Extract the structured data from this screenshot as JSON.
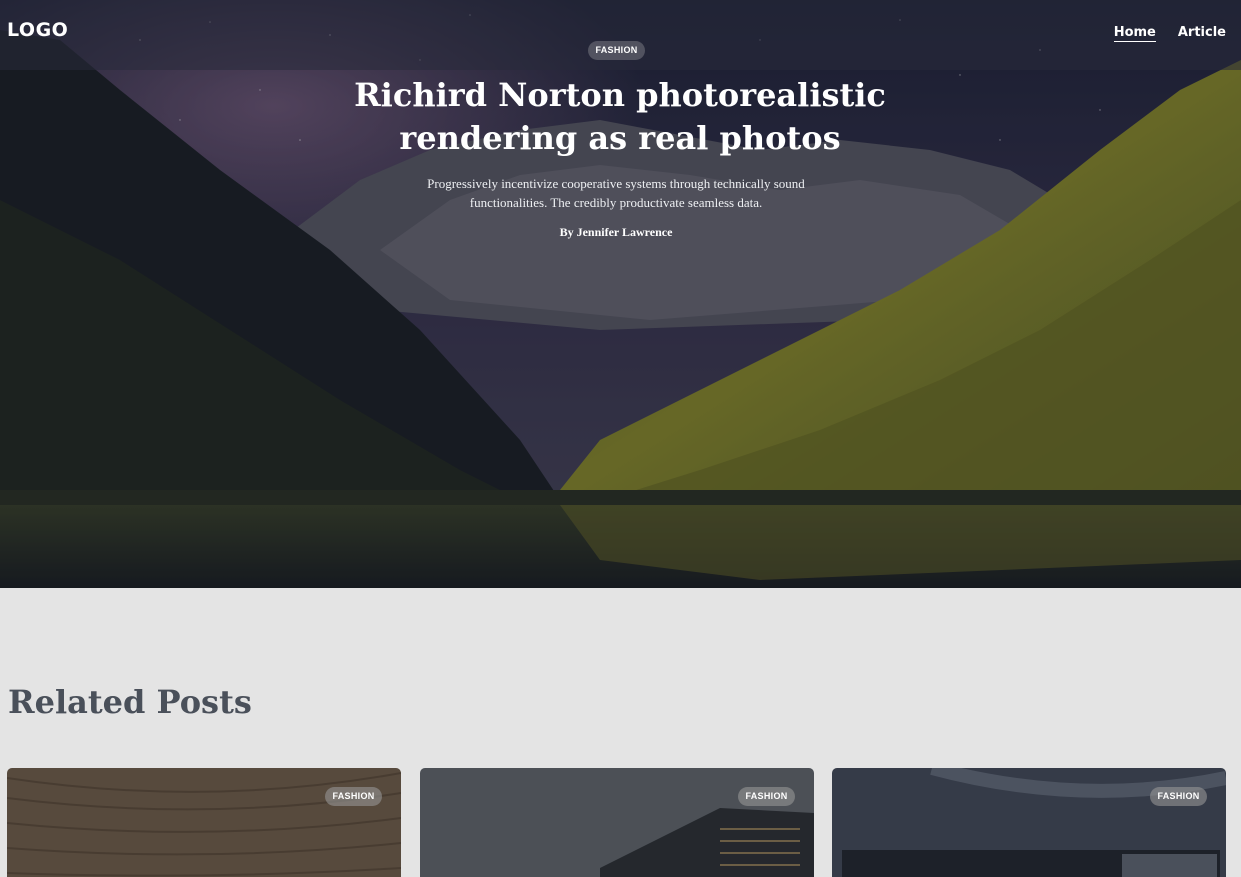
{
  "header": {
    "logo": "LOGO",
    "nav": [
      {
        "label": "Home",
        "active": true
      },
      {
        "label": "Article",
        "active": false
      }
    ]
  },
  "hero": {
    "category": "FASHION",
    "title": "Richird Norton photorealistic rendering as real photos",
    "description": "Progressively incentivize cooperative systems through technically sound functionalities. The credibly productivate seamless data.",
    "author": "By Jennifer Lawrence"
  },
  "related": {
    "heading": "Related Posts",
    "posts": [
      {
        "category": "FASHION"
      },
      {
        "category": "FASHION"
      },
      {
        "category": "FASHION"
      }
    ]
  }
}
